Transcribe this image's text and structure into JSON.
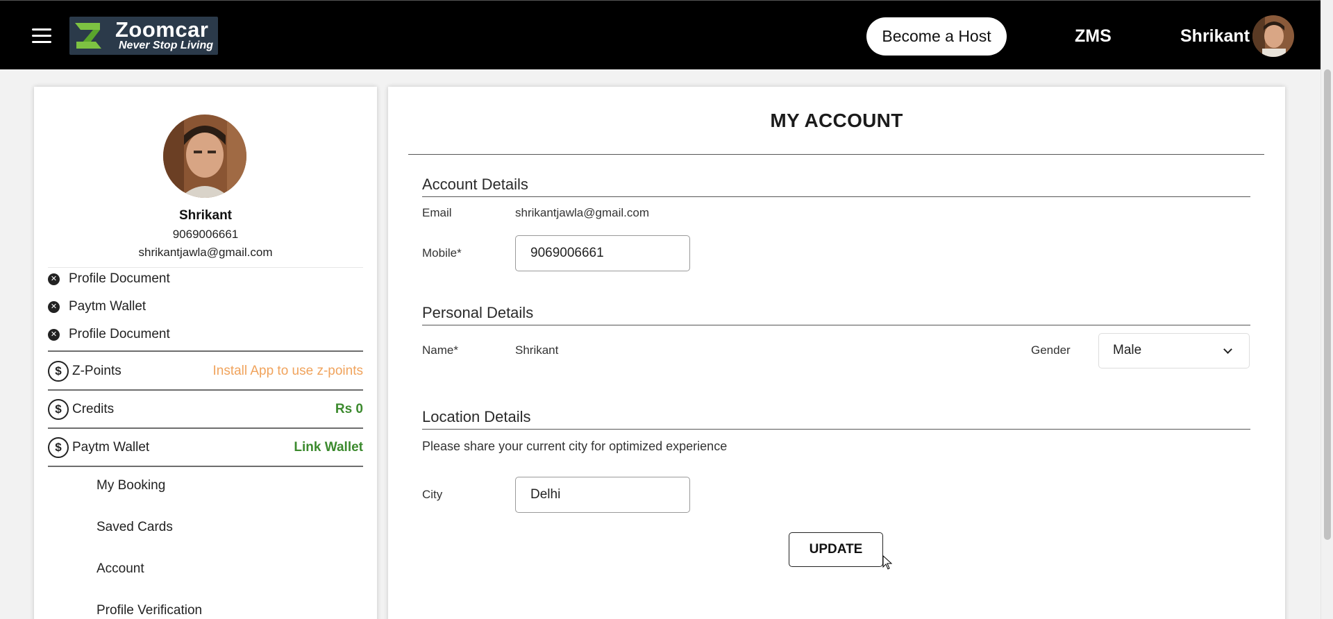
{
  "header": {
    "logo_name": "Zoomcar",
    "logo_tagline": "Never Stop Living",
    "become_host_label": "Become a Host",
    "zms_label": "ZMS",
    "user_name": "Shrikant"
  },
  "sidebar": {
    "name": "Shrikant",
    "phone": "9069006661",
    "email": "shrikantjawla@gmail.com",
    "documents": [
      {
        "label": "Profile Document"
      },
      {
        "label": "Paytm Wallet"
      },
      {
        "label": "Profile Document"
      }
    ],
    "money": [
      {
        "label": "Z-Points",
        "value": "Install App to use z-points"
      },
      {
        "label": "Credits",
        "value": "Rs 0"
      },
      {
        "label": "Paytm Wallet",
        "value": "Link Wallet"
      }
    ],
    "menu": [
      {
        "label": "My Booking"
      },
      {
        "label": "Saved Cards"
      },
      {
        "label": "Account"
      },
      {
        "label": "Profile Verification"
      }
    ]
  },
  "main": {
    "title": "MY ACCOUNT",
    "account_details": {
      "heading": "Account Details",
      "email_label": "Email",
      "email_value": "shrikantjawla@gmail.com",
      "mobile_label": "Mobile*",
      "mobile_value": "9069006661"
    },
    "personal_details": {
      "heading": "Personal Details",
      "name_label": "Name*",
      "name_value": "Shrikant",
      "gender_label": "Gender",
      "gender_value": "Male"
    },
    "location_details": {
      "heading": "Location Details",
      "hint": "Please share your current city for optimized experience",
      "city_label": "City",
      "city_value": "Delhi"
    },
    "update_label": "UPDATE"
  },
  "colors": {
    "topbar": "#000000",
    "orange_text": "#f0a35c",
    "green_text": "#3c8a2e"
  }
}
